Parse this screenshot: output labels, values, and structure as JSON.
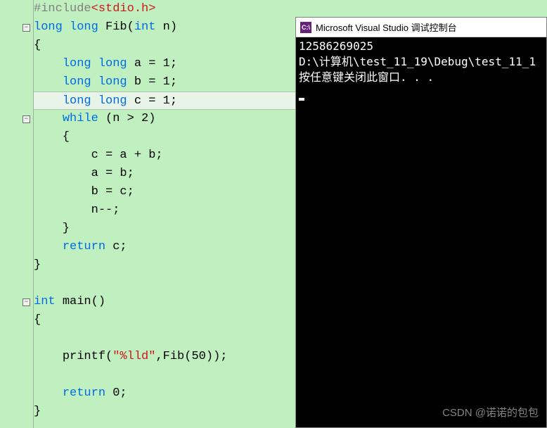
{
  "editor": {
    "lines": [
      {
        "tokens": [
          [
            "pp",
            "#include"
          ],
          [
            "str",
            "<stdio.h>"
          ]
        ]
      },
      {
        "fold": true,
        "tokens": [
          [
            "kw",
            "long"
          ],
          [
            "txt",
            " "
          ],
          [
            "kw",
            "long"
          ],
          [
            "txt",
            " "
          ],
          [
            "fn",
            "Fib"
          ],
          [
            "txt",
            "("
          ],
          [
            "kw",
            "int"
          ],
          [
            "txt",
            " n)"
          ]
        ]
      },
      {
        "tokens": [
          [
            "txt",
            "{"
          ]
        ]
      },
      {
        "tokens": [
          [
            "txt",
            "    "
          ],
          [
            "kw",
            "long"
          ],
          [
            "txt",
            " "
          ],
          [
            "kw",
            "long"
          ],
          [
            "txt",
            " a = 1;"
          ]
        ]
      },
      {
        "tokens": [
          [
            "txt",
            "    "
          ],
          [
            "kw",
            "long"
          ],
          [
            "txt",
            " "
          ],
          [
            "kw",
            "long"
          ],
          [
            "txt",
            " b = 1;"
          ]
        ]
      },
      {
        "highlighted": true,
        "tokens": [
          [
            "txt",
            "    "
          ],
          [
            "kw",
            "long"
          ],
          [
            "txt",
            " "
          ],
          [
            "kw",
            "long"
          ],
          [
            "txt",
            " c = 1;"
          ]
        ]
      },
      {
        "fold": true,
        "tokens": [
          [
            "txt",
            "    "
          ],
          [
            "kw",
            "while"
          ],
          [
            "txt",
            " (n > 2)"
          ]
        ]
      },
      {
        "tokens": [
          [
            "txt",
            "    {"
          ]
        ]
      },
      {
        "tokens": [
          [
            "txt",
            "        c = a + b;"
          ]
        ]
      },
      {
        "tokens": [
          [
            "txt",
            "        a = b;"
          ]
        ]
      },
      {
        "tokens": [
          [
            "txt",
            "        b = c;"
          ]
        ]
      },
      {
        "tokens": [
          [
            "txt",
            "        n--;"
          ]
        ]
      },
      {
        "tokens": [
          [
            "txt",
            "    }"
          ]
        ]
      },
      {
        "tokens": [
          [
            "txt",
            "    "
          ],
          [
            "kw",
            "return"
          ],
          [
            "txt",
            " c;"
          ]
        ]
      },
      {
        "tokens": [
          [
            "txt",
            "}"
          ]
        ]
      },
      {
        "tokens": [
          [
            "txt",
            ""
          ]
        ]
      },
      {
        "fold": true,
        "tokens": [
          [
            "kw",
            "int"
          ],
          [
            "txt",
            " "
          ],
          [
            "fn",
            "main"
          ],
          [
            "txt",
            "()"
          ]
        ]
      },
      {
        "tokens": [
          [
            "txt",
            "{"
          ]
        ]
      },
      {
        "tokens": [
          [
            "txt",
            ""
          ]
        ]
      },
      {
        "tokens": [
          [
            "txt",
            "    "
          ],
          [
            "fn",
            "printf"
          ],
          [
            "txt",
            "("
          ],
          [
            "str",
            "\"%lld\""
          ],
          [
            "txt",
            ","
          ],
          [
            "fn",
            "Fib"
          ],
          [
            "txt",
            "(50));"
          ]
        ]
      },
      {
        "tokens": [
          [
            "txt",
            ""
          ]
        ]
      },
      {
        "tokens": [
          [
            "txt",
            "    "
          ],
          [
            "kw",
            "return"
          ],
          [
            "txt",
            " 0;"
          ]
        ]
      },
      {
        "tokens": [
          [
            "txt",
            "}"
          ]
        ]
      }
    ]
  },
  "console": {
    "icon_text": "C:\\",
    "title": "Microsoft Visual Studio 调试控制台",
    "lines": [
      "12586269025",
      "D:\\计算机\\test_11_19\\Debug\\test_11_1",
      "按任意键关闭此窗口. . ."
    ]
  },
  "watermark": "CSDN @诺诺的包包"
}
